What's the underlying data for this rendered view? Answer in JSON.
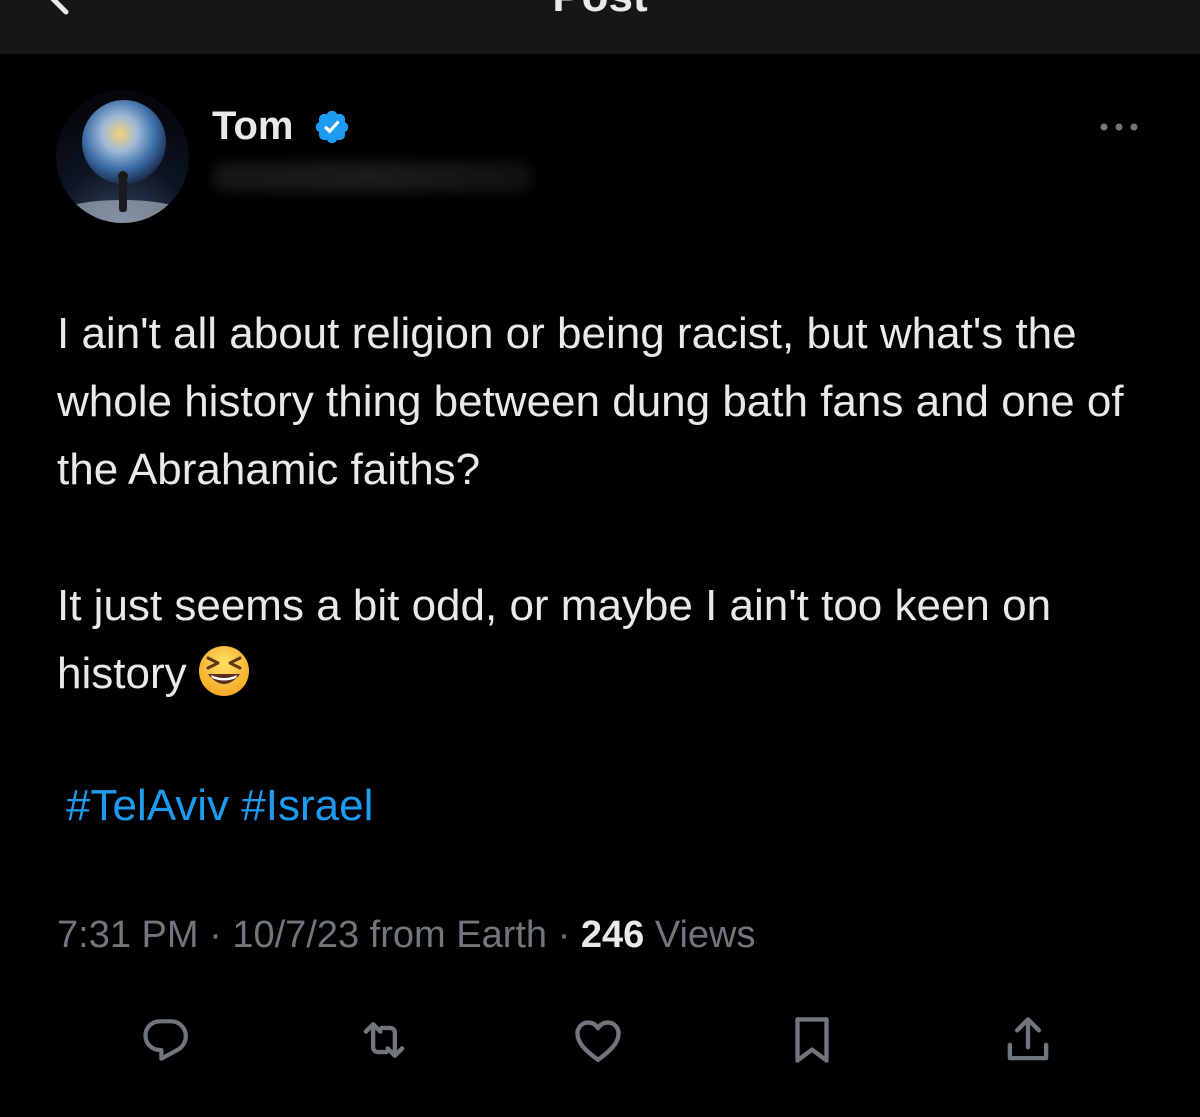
{
  "header": {
    "title": "Post"
  },
  "post": {
    "author": {
      "name": "Tom"
    },
    "paragraphs": [
      "I ain't all about religion or being racist, but what's the whole history thing between dung bath fans and one of the Abrahamic faiths?",
      "It just seems a bit odd, or maybe I ain't too keen on history"
    ],
    "emoji": "😆",
    "hashtags": [
      "#TelAviv",
      "#Israel"
    ],
    "time": "7:31 PM",
    "date": "10/7/23",
    "location": "from Earth",
    "views_count": "246",
    "views_label": "Views",
    "separator": "·"
  },
  "actions": {
    "reply": "reply-icon",
    "repost": "repost-icon",
    "like": "heart-icon",
    "bookmark": "bookmark-icon",
    "share": "share-icon"
  },
  "colors": {
    "background": "#000000",
    "text": "#e7e9ea",
    "muted": "#71767b",
    "link": "#1d9bf0",
    "verified": "#1d9bf0"
  }
}
